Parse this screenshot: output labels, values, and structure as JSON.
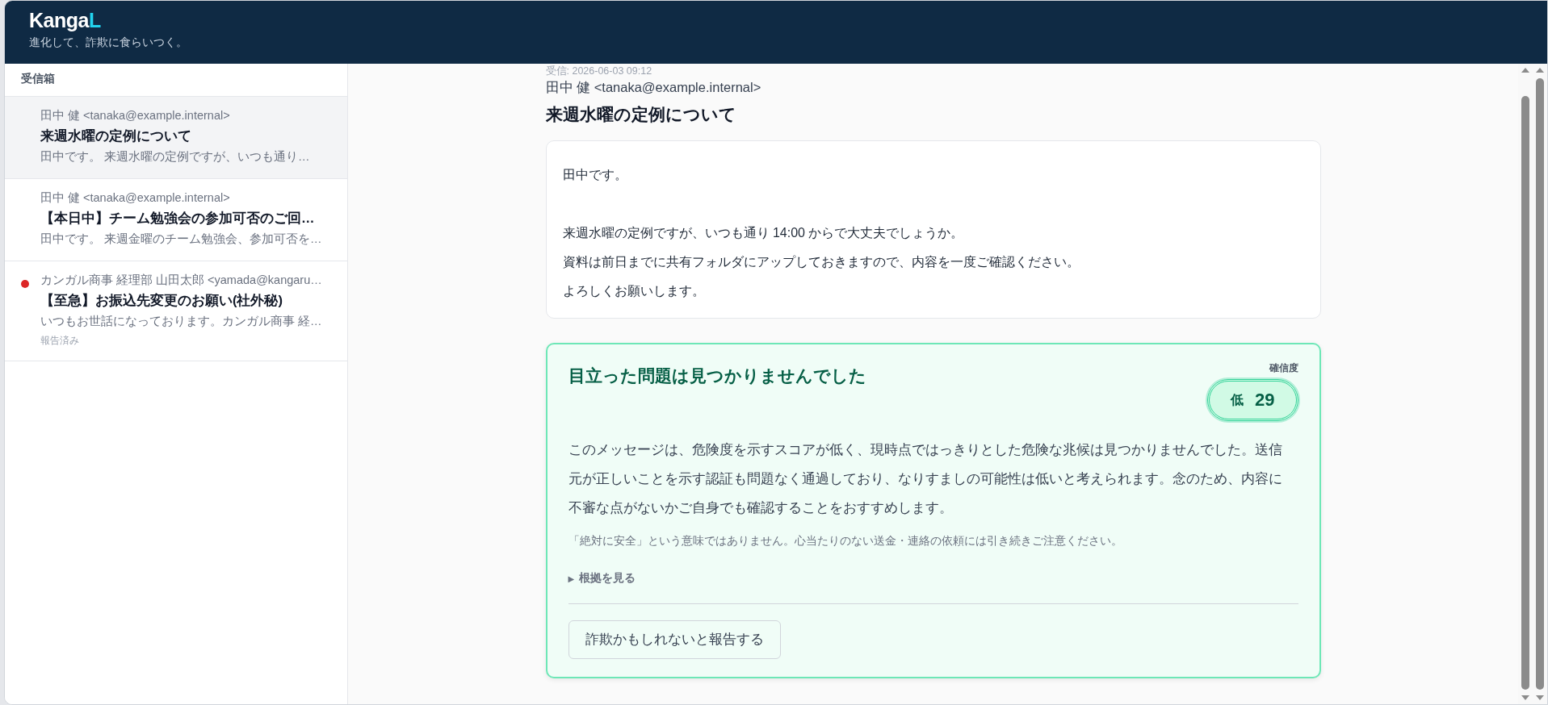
{
  "app": {
    "logo_main": "Kanga",
    "logo_accent": "L",
    "tagline": "進化して、詐欺に食らいつく。"
  },
  "sidebar": {
    "title": "受信箱",
    "items": [
      {
        "sender": "田中 健 <tanaka@example.internal>",
        "subject": "来週水曜の定例について",
        "preview": "田中です。 来週水曜の定例ですが、いつも通り…",
        "selected": true,
        "alert": false
      },
      {
        "sender": "田中 健 <tanaka@example.internal>",
        "subject": "【本日中】チーム勉強会の参加可否のご回…",
        "preview": "田中です。 来週金曜のチーム勉強会、参加可否を…",
        "selected": false,
        "alert": false
      },
      {
        "sender": "カンガル商事 経理部 山田太郎 <yamada@kangaru…",
        "subject": "【至急】お振込先変更のお願い(社外秘)",
        "preview": "いつもお世話になっております。カンガル商事 経…",
        "selected": false,
        "alert": true,
        "status": "報告済み"
      }
    ]
  },
  "message": {
    "received": "受信: 2026-06-03 09:12",
    "sender": "田中 健 <tanaka@example.internal>",
    "subject": "来週水曜の定例について",
    "body": [
      [
        "田中です。"
      ],
      [
        "来週水曜の定例ですが、いつも通り 14:00 からで大丈夫でしょうか。",
        "資料は前日までに共有フォルダにアップしておきますので、内容を一度ご確認ください。",
        "よろしくお願いします。"
      ]
    ]
  },
  "verdict": {
    "title": "目立った問題は見つかりませんでした",
    "confidence_label": "確信度",
    "confidence_level": "低",
    "score": "29",
    "summary": "このメッセージは、危険度を示すスコアが低く、現時点ではっきりとした危険な兆候は見つかりませんでした。送信元が正しいことを示す認証も問題なく通過しており、なりすましの可能性は低いと考えられます。念のため、内容に不審な点がないかご自身でも確認することをおすすめします。",
    "note": "「絶対に安全」という意味ではありません。心当たりのない送金・連絡の依頼には引き続きご注意ください。",
    "details": {
      "marker": "▶",
      "label": "根拠を見る",
      "expanded": false
    },
    "report_button": "詐欺かもしれないと報告する"
  }
}
